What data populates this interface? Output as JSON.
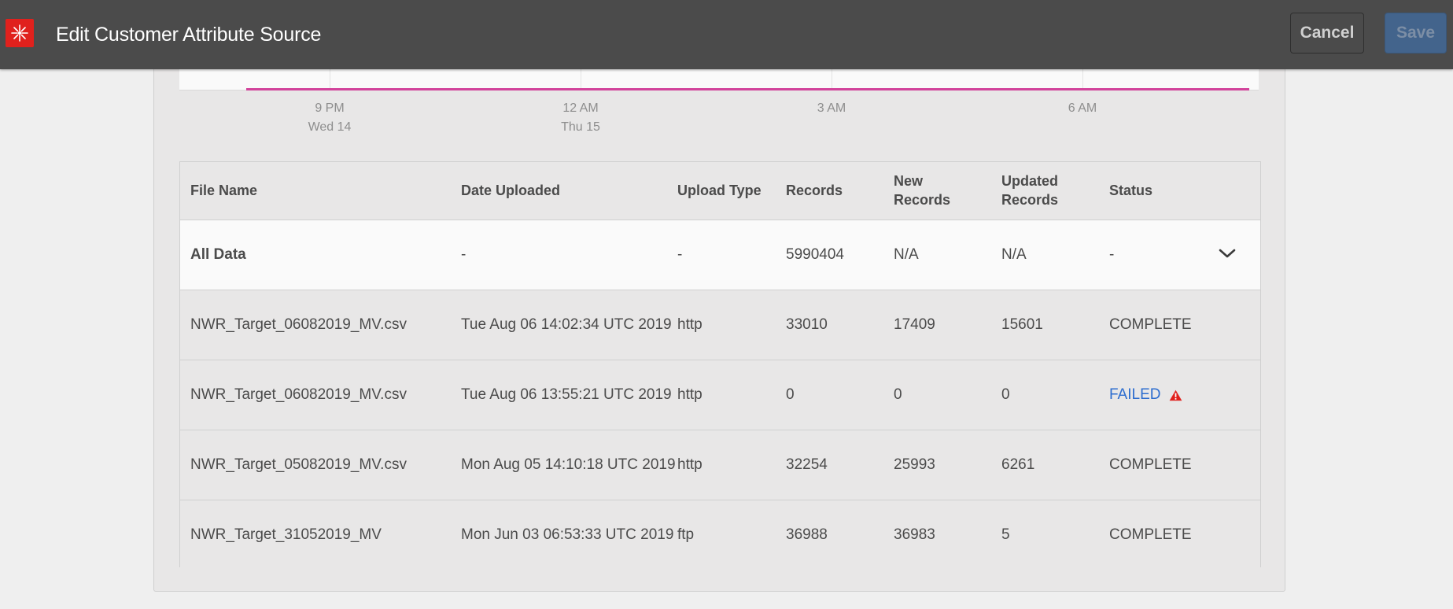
{
  "app": {
    "title": "Edit Customer Attribute Source",
    "cancel_label": "Cancel",
    "save_label": "Save"
  },
  "timeline": {
    "ticks": [
      {
        "time": "9 PM",
        "date": "Wed 14"
      },
      {
        "time": "12 AM",
        "date": "Thu 15"
      },
      {
        "time": "3 AM",
        "date": ""
      },
      {
        "time": "6 AM",
        "date": ""
      }
    ],
    "series_color": "#d2439b"
  },
  "table": {
    "headers": {
      "file_name": "File Name",
      "date_uploaded": "Date Uploaded",
      "upload_type": "Upload Type",
      "records": "Records",
      "new_records": "New Records",
      "updated_records": "Updated Records",
      "status": "Status"
    },
    "rows": [
      {
        "file_name": "All Data",
        "date_uploaded": "-",
        "upload_type": "-",
        "records": "5990404",
        "new_records": "N/A",
        "updated_records": "N/A",
        "status": "-"
      },
      {
        "file_name": "NWR_Target_06082019_MV.csv",
        "date_uploaded": "Tue Aug 06 14:02:34 UTC 2019",
        "upload_type": "http",
        "records": "33010",
        "new_records": "17409",
        "updated_records": "15601",
        "status": "COMPLETE"
      },
      {
        "file_name": "NWR_Target_06082019_MV.csv",
        "date_uploaded": "Tue Aug 06 13:55:21 UTC 2019",
        "upload_type": "http",
        "records": "0",
        "new_records": "0",
        "updated_records": "0",
        "status": "FAILED"
      },
      {
        "file_name": "NWR_Target_05082019_MV.csv",
        "date_uploaded": "Mon Aug 05 14:10:18 UTC 2019",
        "upload_type": "http",
        "records": "32254",
        "new_records": "25993",
        "updated_records": "6261",
        "status": "COMPLETE"
      },
      {
        "file_name": "NWR_Target_31052019_MV",
        "date_uploaded": "Mon Jun 03 06:53:33 UTC 2019",
        "upload_type": "ftp",
        "records": "36988",
        "new_records": "36983",
        "updated_records": "5",
        "status": "COMPLETE"
      }
    ]
  },
  "colors": {
    "topbar": "#4b4b4b",
    "brand": "#e0211d",
    "failed_link": "#2d6dcf",
    "warning": "#e0211d"
  },
  "icons": {
    "logo": "adobe-experience-cloud-icon",
    "expand": "chevron-down-icon",
    "warning": "warning-triangle-icon"
  }
}
